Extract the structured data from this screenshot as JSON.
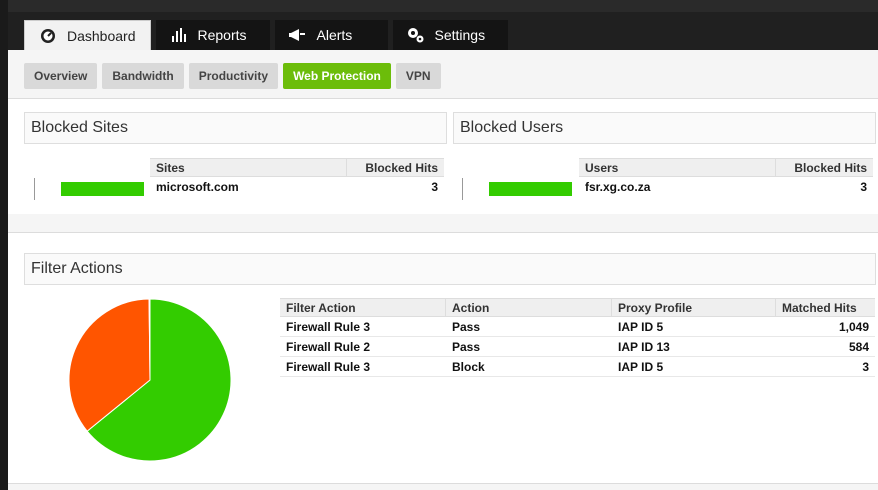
{
  "tabs": [
    {
      "label": "Dashboard",
      "icon": "dashboard-gauge-icon",
      "active": true
    },
    {
      "label": "Reports",
      "icon": "bar-chart-icon",
      "active": false
    },
    {
      "label": "Alerts",
      "icon": "megaphone-icon",
      "active": false
    },
    {
      "label": "Settings",
      "icon": "gears-icon",
      "active": false
    }
  ],
  "subtabs": [
    {
      "label": "Overview",
      "active": false
    },
    {
      "label": "Bandwidth",
      "active": false
    },
    {
      "label": "Productivity",
      "active": false
    },
    {
      "label": "Web Protection",
      "active": true
    },
    {
      "label": "VPN",
      "active": false
    }
  ],
  "blocked_sites": {
    "title": "Blocked Sites",
    "columns": [
      "Sites",
      "Blocked Hits"
    ],
    "rows": [
      {
        "name": "microsoft.com",
        "hits": "3",
        "bar_fraction": 1.0
      }
    ]
  },
  "blocked_users": {
    "title": "Blocked Users",
    "columns": [
      "Users",
      "Blocked Hits"
    ],
    "rows": [
      {
        "name": "fsr.xg.co.za",
        "hits": "3",
        "bar_fraction": 1.0
      }
    ]
  },
  "filter_actions": {
    "title": "Filter Actions",
    "columns": [
      "Filter Action",
      "Action",
      "Proxy Profile",
      "Matched Hits"
    ],
    "rows": [
      {
        "filter_action": "Firewall Rule 3",
        "action": "Pass",
        "proxy_profile": "IAP ID 5",
        "matched_hits": "1,049"
      },
      {
        "filter_action": "Firewall Rule 2",
        "action": "Pass",
        "proxy_profile": "IAP ID 13",
        "matched_hits": "584"
      },
      {
        "filter_action": "Firewall Rule 3",
        "action": "Block",
        "proxy_profile": "IAP ID 5",
        "matched_hits": "3"
      }
    ]
  },
  "chart_data": {
    "type": "pie",
    "slices": [
      {
        "value": 1049,
        "color": "#33cc00"
      },
      {
        "value": 584,
        "color": "#ff5500"
      },
      {
        "value": 3,
        "color": "#ffcc00"
      }
    ]
  },
  "colors": {
    "accent": "#6cbd0a",
    "bar": "#33cc00",
    "pie_green": "#33cc00",
    "pie_orange": "#ff5500"
  }
}
